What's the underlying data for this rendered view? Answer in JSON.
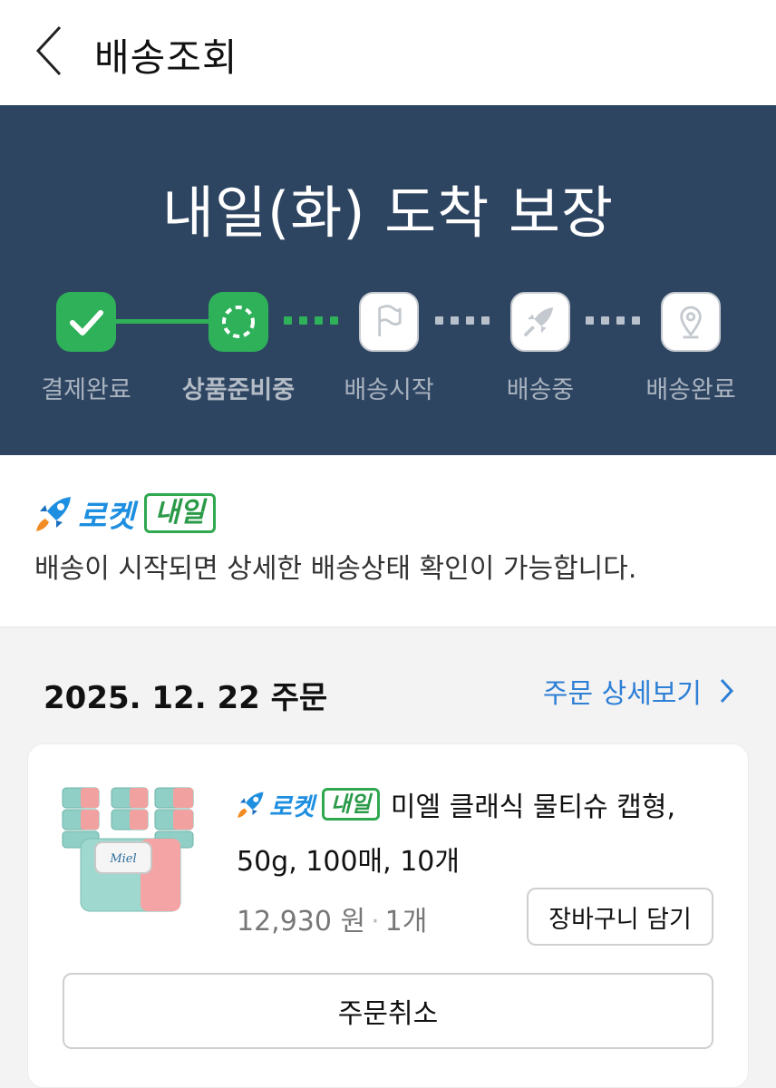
{
  "header": {
    "title": "배송조회"
  },
  "hero": {
    "title": "내일(화) 도착 보장",
    "steps": [
      {
        "label": "결제완료",
        "status": "done",
        "icon": "check-icon"
      },
      {
        "label": "상품준비중",
        "status": "current",
        "icon": "spinner-icon"
      },
      {
        "label": "배송시작",
        "status": "pending",
        "icon": "flag-icon"
      },
      {
        "label": "배송중",
        "status": "pending",
        "icon": "rocket-icon"
      },
      {
        "label": "배송완료",
        "status": "pending",
        "icon": "location-pin-icon"
      }
    ]
  },
  "rocket": {
    "brand": "로켓",
    "badge": "내일",
    "description": "배송이 시작되면 상세한 배송상태 확인이 가능합니다."
  },
  "order": {
    "date_label": "2025. 12. 22 주문",
    "detail_link": "주문 상세보기",
    "product": {
      "brand": "로켓",
      "badge": "내일",
      "name_line1": "미엘 클래식 물티슈 캡형,",
      "name_line2": "50g, 100매, 10개",
      "price": "12,930 원",
      "separator": "·",
      "quantity": "1개",
      "thumb_brand": "Miel"
    },
    "cart_button": "장바구니 담기",
    "cancel_button": "주문취소"
  },
  "colors": {
    "hero_bg": "#2e4562",
    "done_green": "#2fb15a",
    "link_blue": "#2e7fd6",
    "rocket_blue": "#1e8fe0"
  }
}
